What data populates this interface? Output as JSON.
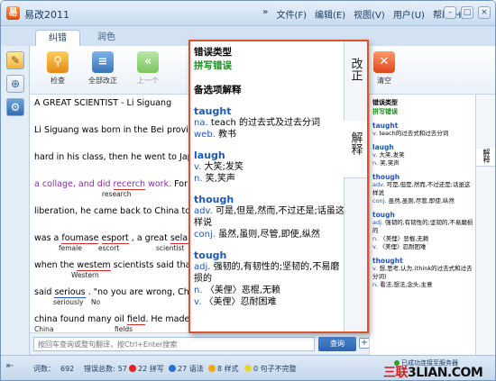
{
  "app": {
    "icon_letter": "易",
    "title": "易改2011"
  },
  "menu": {
    "items": [
      "文件(F)",
      "编辑(E)",
      "视图(V)",
      "用户(U)",
      "帮助(H)"
    ],
    "chevron": "»"
  },
  "window_buttons": {
    "minimize": "–",
    "maximize": "□",
    "close": "×"
  },
  "tabs": {
    "correct": "纠错",
    "polish": "润色"
  },
  "toolbar": {
    "check": "检查",
    "correct_all": "全部改正",
    "prev": "上一个",
    "clear": "清空"
  },
  "editor": {
    "lines": [
      "A GREAT SCIENTIST - Li Siguang",
      "Li Siguang was born in the Bei province i",
      "hard in his class, then he went to Japan t",
      "a collage, and did recerch work. For polit",
      "liberation, he came back to China to take",
      "was a foumase esport , a great selantish",
      "when the westem scientists said that. \"C",
      "said serious . \"no you are wrong, China i",
      "china found many oil field. He made grea"
    ],
    "line4": {
      "a": "a collage, and did ",
      "err": "recerch",
      "b": " work. ",
      "c": "For polit"
    },
    "line6": {
      "a": "was a ",
      "e1": "foumase",
      "b": " ",
      "e2": "esport",
      "c": " , a great ",
      "e3": "selantish"
    },
    "line7": {
      "a": "when the ",
      "e1": "westem",
      "b": " scientists said that. \"C"
    },
    "line8": {
      "a": "said ",
      "e1": "serious",
      "b": " . \"no you are wrong, China i"
    },
    "line9": {
      "a": "china found many oil ",
      "e1": "field",
      "b": ". He made grea"
    },
    "suggestions": {
      "research": "research",
      "female": "female",
      "escort": "escort",
      "scientist": "scientist",
      "western": "Western",
      "seriously": "seriously",
      "no": "No",
      "china_cap": "China",
      "fields": "fields"
    }
  },
  "search": {
    "placeholder": "按回车查询或整句翻译，按Ctrl+Enter搜索",
    "button": "查询",
    "plus": "+"
  },
  "popup": {
    "error_type_label": "错误类型",
    "error_type": "拼写错误",
    "options_label": "备选项解释",
    "side_tabs": [
      "改正",
      "解释"
    ],
    "entries": [
      {
        "word": "taught",
        "defs": [
          {
            "pos": "na.",
            "text": "teach 的过去式及过去分词"
          },
          {
            "pos": "web.",
            "text": "教书"
          }
        ]
      },
      {
        "word": "laugh",
        "defs": [
          {
            "pos": "v.",
            "text": "大笑;发笑"
          },
          {
            "pos": "n.",
            "text": "笑,笑声"
          }
        ]
      },
      {
        "word": "though",
        "defs": [
          {
            "pos": "adv.",
            "text": "可是,但是,然而,不过还是;话虽这样说"
          },
          {
            "pos": "conj.",
            "text": "虽然,虽则,尽管,即使,纵然"
          }
        ]
      },
      {
        "word": "tough",
        "defs": [
          {
            "pos": "adj.",
            "text": "强韧的,有韧性的;坚韧的,不易磨损的"
          },
          {
            "pos": "n.",
            "text": "〈美俚〉恶棍,无赖"
          },
          {
            "pos": "v.",
            "text": "〈美俚〉忍耐困难"
          }
        ]
      }
    ]
  },
  "right_pane": {
    "error_type_label": "错误类型",
    "error_type": "拼写错误",
    "side_tab": "解释",
    "entries": [
      {
        "word": "taught",
        "defs": [
          {
            "pos": "v.",
            "text": "teach的过去式和过去分词"
          }
        ]
      },
      {
        "word": "laugh",
        "defs": [
          {
            "pos": "v.",
            "text": "大笑,发笑"
          },
          {
            "pos": "n.",
            "text": "笑,笑声"
          }
        ]
      },
      {
        "word": "though",
        "defs": [
          {
            "pos": "adv.",
            "text": "可是,但是,然而,不过还是;话虽这样说"
          },
          {
            "pos": "conj.",
            "text": "虽然,虽则,尽管,即使,纵然"
          }
        ]
      },
      {
        "word": "tough",
        "defs": [
          {
            "pos": "adj.",
            "text": "强韧的,有韧性的;坚韧的,不易磨损的"
          },
          {
            "pos": "n.",
            "text": "〈美俚〉恶棍,无赖"
          },
          {
            "pos": "v.",
            "text": "〈美俚〉忍耐困难"
          }
        ]
      },
      {
        "word": "thought",
        "defs": [
          {
            "pos": "v.",
            "text": "想,思考,认为,(think的过去式和过去分词)"
          },
          {
            "pos": "n.",
            "text": "看法,想法,念头,主意"
          }
        ]
      }
    ]
  },
  "status": {
    "word_count_label": "词数：",
    "word_count": "692",
    "total_errors_label": "错误总数:",
    "total_errors": "57",
    "spelling": "22 拼写",
    "grammar": "27 语法",
    "style": "8 样式",
    "incomplete": "0 句子不完整",
    "connection": "已成功连接至服务器",
    "colors": {
      "spelling": "#e02424",
      "grammar": "#2a6fd6",
      "style": "#f0a81a",
      "incomplete": "#e8d23a",
      "connected": "#2aa02a"
    }
  },
  "watermark": {
    "part1": "三联",
    "part2": "3LIAN.COM"
  }
}
